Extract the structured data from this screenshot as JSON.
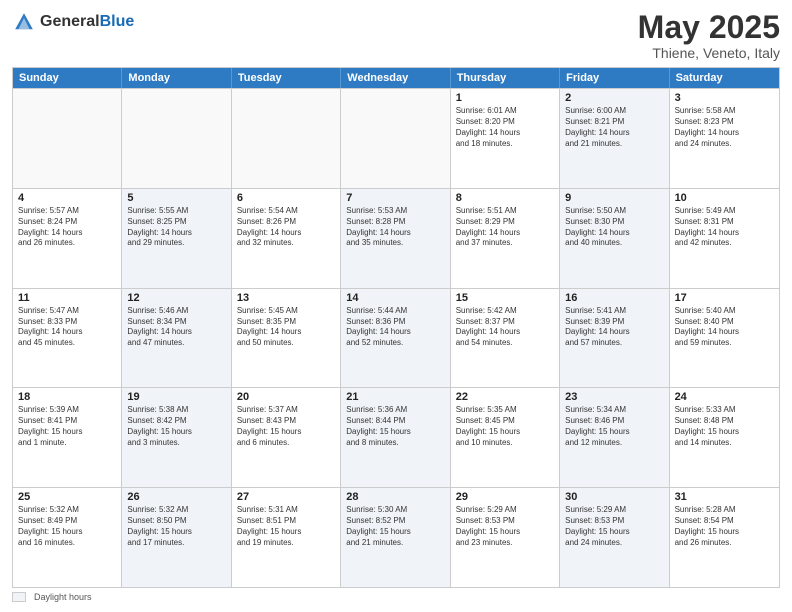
{
  "header": {
    "logo_general": "General",
    "logo_blue": "Blue",
    "month_title": "May 2025",
    "location": "Thiene, Veneto, Italy"
  },
  "days_of_week": [
    "Sunday",
    "Monday",
    "Tuesday",
    "Wednesday",
    "Thursday",
    "Friday",
    "Saturday"
  ],
  "legend_label": "Daylight hours",
  "weeks": [
    [
      {
        "day": "",
        "text": "",
        "shaded": false,
        "empty": true
      },
      {
        "day": "",
        "text": "",
        "shaded": false,
        "empty": true
      },
      {
        "day": "",
        "text": "",
        "shaded": false,
        "empty": true
      },
      {
        "day": "",
        "text": "",
        "shaded": false,
        "empty": true
      },
      {
        "day": "1",
        "text": "Sunrise: 6:01 AM\nSunset: 8:20 PM\nDaylight: 14 hours\nand 18 minutes.",
        "shaded": false,
        "empty": false
      },
      {
        "day": "2",
        "text": "Sunrise: 6:00 AM\nSunset: 8:21 PM\nDaylight: 14 hours\nand 21 minutes.",
        "shaded": true,
        "empty": false
      },
      {
        "day": "3",
        "text": "Sunrise: 5:58 AM\nSunset: 8:23 PM\nDaylight: 14 hours\nand 24 minutes.",
        "shaded": false,
        "empty": false
      }
    ],
    [
      {
        "day": "4",
        "text": "Sunrise: 5:57 AM\nSunset: 8:24 PM\nDaylight: 14 hours\nand 26 minutes.",
        "shaded": false,
        "empty": false
      },
      {
        "day": "5",
        "text": "Sunrise: 5:55 AM\nSunset: 8:25 PM\nDaylight: 14 hours\nand 29 minutes.",
        "shaded": true,
        "empty": false
      },
      {
        "day": "6",
        "text": "Sunrise: 5:54 AM\nSunset: 8:26 PM\nDaylight: 14 hours\nand 32 minutes.",
        "shaded": false,
        "empty": false
      },
      {
        "day": "7",
        "text": "Sunrise: 5:53 AM\nSunset: 8:28 PM\nDaylight: 14 hours\nand 35 minutes.",
        "shaded": true,
        "empty": false
      },
      {
        "day": "8",
        "text": "Sunrise: 5:51 AM\nSunset: 8:29 PM\nDaylight: 14 hours\nand 37 minutes.",
        "shaded": false,
        "empty": false
      },
      {
        "day": "9",
        "text": "Sunrise: 5:50 AM\nSunset: 8:30 PM\nDaylight: 14 hours\nand 40 minutes.",
        "shaded": true,
        "empty": false
      },
      {
        "day": "10",
        "text": "Sunrise: 5:49 AM\nSunset: 8:31 PM\nDaylight: 14 hours\nand 42 minutes.",
        "shaded": false,
        "empty": false
      }
    ],
    [
      {
        "day": "11",
        "text": "Sunrise: 5:47 AM\nSunset: 8:33 PM\nDaylight: 14 hours\nand 45 minutes.",
        "shaded": false,
        "empty": false
      },
      {
        "day": "12",
        "text": "Sunrise: 5:46 AM\nSunset: 8:34 PM\nDaylight: 14 hours\nand 47 minutes.",
        "shaded": true,
        "empty": false
      },
      {
        "day": "13",
        "text": "Sunrise: 5:45 AM\nSunset: 8:35 PM\nDaylight: 14 hours\nand 50 minutes.",
        "shaded": false,
        "empty": false
      },
      {
        "day": "14",
        "text": "Sunrise: 5:44 AM\nSunset: 8:36 PM\nDaylight: 14 hours\nand 52 minutes.",
        "shaded": true,
        "empty": false
      },
      {
        "day": "15",
        "text": "Sunrise: 5:42 AM\nSunset: 8:37 PM\nDaylight: 14 hours\nand 54 minutes.",
        "shaded": false,
        "empty": false
      },
      {
        "day": "16",
        "text": "Sunrise: 5:41 AM\nSunset: 8:39 PM\nDaylight: 14 hours\nand 57 minutes.",
        "shaded": true,
        "empty": false
      },
      {
        "day": "17",
        "text": "Sunrise: 5:40 AM\nSunset: 8:40 PM\nDaylight: 14 hours\nand 59 minutes.",
        "shaded": false,
        "empty": false
      }
    ],
    [
      {
        "day": "18",
        "text": "Sunrise: 5:39 AM\nSunset: 8:41 PM\nDaylight: 15 hours\nand 1 minute.",
        "shaded": false,
        "empty": false
      },
      {
        "day": "19",
        "text": "Sunrise: 5:38 AM\nSunset: 8:42 PM\nDaylight: 15 hours\nand 3 minutes.",
        "shaded": true,
        "empty": false
      },
      {
        "day": "20",
        "text": "Sunrise: 5:37 AM\nSunset: 8:43 PM\nDaylight: 15 hours\nand 6 minutes.",
        "shaded": false,
        "empty": false
      },
      {
        "day": "21",
        "text": "Sunrise: 5:36 AM\nSunset: 8:44 PM\nDaylight: 15 hours\nand 8 minutes.",
        "shaded": true,
        "empty": false
      },
      {
        "day": "22",
        "text": "Sunrise: 5:35 AM\nSunset: 8:45 PM\nDaylight: 15 hours\nand 10 minutes.",
        "shaded": false,
        "empty": false
      },
      {
        "day": "23",
        "text": "Sunrise: 5:34 AM\nSunset: 8:46 PM\nDaylight: 15 hours\nand 12 minutes.",
        "shaded": true,
        "empty": false
      },
      {
        "day": "24",
        "text": "Sunrise: 5:33 AM\nSunset: 8:48 PM\nDaylight: 15 hours\nand 14 minutes.",
        "shaded": false,
        "empty": false
      }
    ],
    [
      {
        "day": "25",
        "text": "Sunrise: 5:32 AM\nSunset: 8:49 PM\nDaylight: 15 hours\nand 16 minutes.",
        "shaded": false,
        "empty": false
      },
      {
        "day": "26",
        "text": "Sunrise: 5:32 AM\nSunset: 8:50 PM\nDaylight: 15 hours\nand 17 minutes.",
        "shaded": true,
        "empty": false
      },
      {
        "day": "27",
        "text": "Sunrise: 5:31 AM\nSunset: 8:51 PM\nDaylight: 15 hours\nand 19 minutes.",
        "shaded": false,
        "empty": false
      },
      {
        "day": "28",
        "text": "Sunrise: 5:30 AM\nSunset: 8:52 PM\nDaylight: 15 hours\nand 21 minutes.",
        "shaded": true,
        "empty": false
      },
      {
        "day": "29",
        "text": "Sunrise: 5:29 AM\nSunset: 8:53 PM\nDaylight: 15 hours\nand 23 minutes.",
        "shaded": false,
        "empty": false
      },
      {
        "day": "30",
        "text": "Sunrise: 5:29 AM\nSunset: 8:53 PM\nDaylight: 15 hours\nand 24 minutes.",
        "shaded": true,
        "empty": false
      },
      {
        "day": "31",
        "text": "Sunrise: 5:28 AM\nSunset: 8:54 PM\nDaylight: 15 hours\nand 26 minutes.",
        "shaded": false,
        "empty": false
      }
    ]
  ]
}
